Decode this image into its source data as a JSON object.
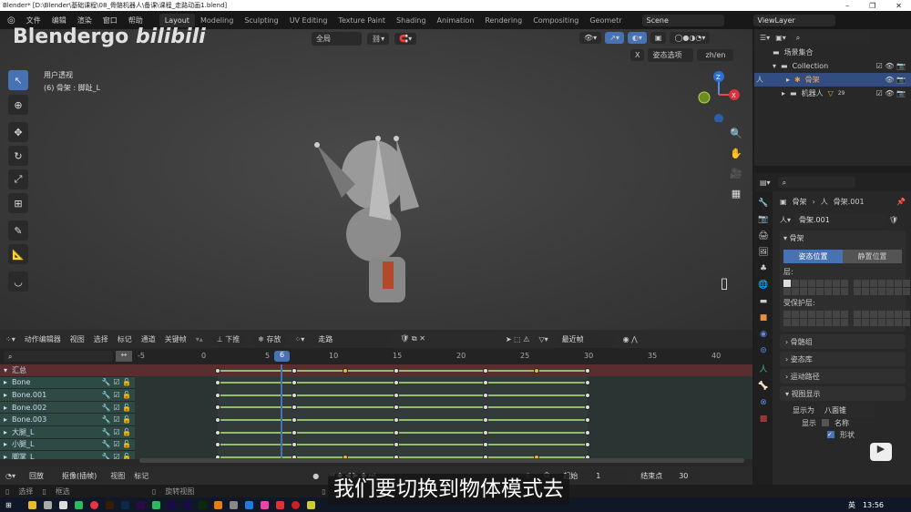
{
  "window": {
    "title": "Blender* [D:\\Blender\\基础课程\\08_骨骼机器人\\备课\\课程_走路动画1.blend]",
    "minimize": "–",
    "restore": "❐",
    "close": "✕"
  },
  "menu": {
    "items": [
      "文件",
      "编辑",
      "渲染",
      "窗口",
      "帮助"
    ],
    "workspaces": [
      "Layout",
      "Modeling",
      "Sculpting",
      "UV Editing",
      "Texture Paint",
      "Shading",
      "Animation",
      "Rendering",
      "Compositing",
      "Geometr"
    ],
    "active": "Layout",
    "scene": "Scene",
    "view_layer": "ViewLayer"
  },
  "watermark": {
    "text": "Blendergo bilibili"
  },
  "viewport": {
    "view_name": "用户透视",
    "active_info": "(6) 骨架 : 脚趾_L",
    "transform_orientation": "全局",
    "pose_options": "姿态选项",
    "x_label": "X",
    "lang_toggle": "zh/en",
    "gizmo": {
      "z": "Z",
      "x": "X"
    }
  },
  "outliner": {
    "rows": [
      {
        "label": "场景集合"
      },
      {
        "label": "Collection"
      },
      {
        "label": "骨架"
      },
      {
        "label": "机器人",
        "badge": "29"
      }
    ]
  },
  "properties": {
    "breadcrumb": [
      "骨架",
      "骨架.001"
    ],
    "data_name": "骨架.001",
    "panel_title": "骨架",
    "pose_position": "姿态位置",
    "rest_position": "静置位置",
    "layers_label": "层:",
    "protected_label": "受保护层:",
    "sections": [
      "骨骼组",
      "姿态库",
      "运动路径",
      "视图显示"
    ],
    "display_as_label": "显示为",
    "display_as_value": "八面锥",
    "show_label": "显示",
    "name_option": "名称",
    "shape_option": "形状",
    "name_checked": false,
    "shape_checked": true
  },
  "dopesheet": {
    "editor": "动作编辑器",
    "menus": [
      "视图",
      "选择",
      "标记",
      "通道",
      "关键帧"
    ],
    "push_down": "下推",
    "stash": "存放",
    "action": "走路",
    "snap": "最近帧",
    "current_frame": "6",
    "ruler": [
      "-5",
      "0",
      "5",
      "10",
      "15",
      "20",
      "25",
      "30",
      "35",
      "40"
    ],
    "channels": [
      "汇总",
      "Bone",
      "Bone.001",
      "Bone.002",
      "Bone.003",
      "大腿_L",
      "小腿_L",
      "脚掌_L"
    ],
    "keyframes": [
      1,
      7,
      11,
      15,
      22,
      26,
      30
    ],
    "selected_keyframes": [
      11,
      26
    ],
    "key_color": "#f5b530"
  },
  "timeline": {
    "playback": "回放",
    "keying": "抠像(插帧)",
    "menus": [
      "视图",
      "标记"
    ],
    "frame": "6",
    "start_label": "起始",
    "start": "1",
    "end_label": "结束点",
    "end": "30"
  },
  "statusbar": {
    "items": [
      "选择",
      "框选",
      "旋转视图",
      "姿态"
    ]
  },
  "subtitle": "我们要切换到物体模式去",
  "taskbar": {
    "clock": "13:56",
    "ime": "英"
  }
}
